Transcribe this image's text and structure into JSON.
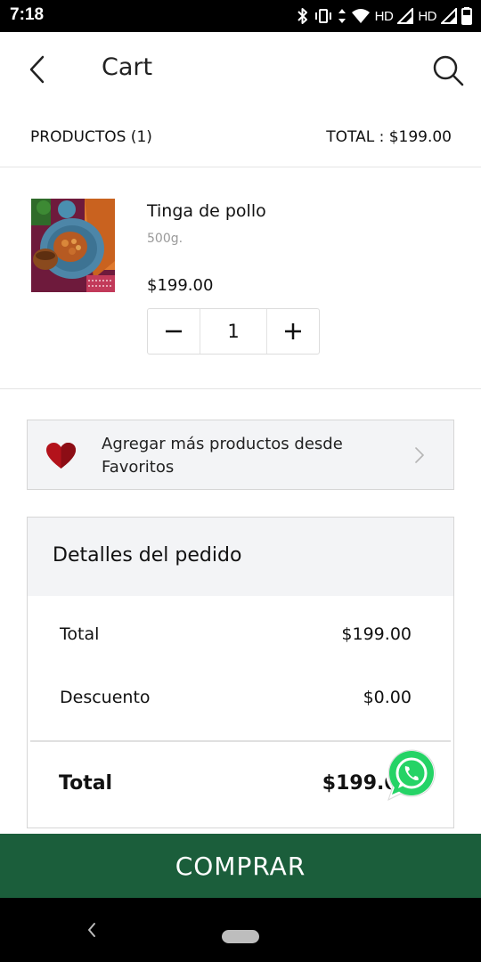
{
  "status_bar": {
    "time": "7:18",
    "network_label_1": "HD",
    "network_label_2": "HD",
    "icons": [
      "bluetooth-icon",
      "vibrate-icon",
      "data-arrows-icon",
      "wifi-icon",
      "signal-icon",
      "signal-icon",
      "battery-icon"
    ]
  },
  "header": {
    "title": "Cart",
    "back_icon": "back-arrow-icon",
    "search_icon": "search-icon"
  },
  "summary": {
    "products_label": "PRODUCTOS (1)",
    "total_label": "TOTAL : $199.00"
  },
  "cart_items": [
    {
      "name": "Tinga de pollo",
      "weight": "500g.",
      "price": "$199.00",
      "quantity": "1"
    }
  ],
  "favorites_banner": {
    "text": "Agregar más productos desde Favoritos",
    "icon": "heart-icon"
  },
  "order_details": {
    "title": "Detalles del pedido",
    "rows": [
      {
        "label": "Total",
        "value": "$199.00"
      },
      {
        "label": "Descuento",
        "value": "$0.00"
      }
    ],
    "grand_total_label": "Total",
    "grand_total_value": "$199.00"
  },
  "checkout": {
    "label": "COMPRAR"
  },
  "colors": {
    "accent_green": "#1b5e3b",
    "whatsapp_green": "#25d366",
    "heart_red": "#b3121b",
    "panel_gray": "#f3f4f6"
  }
}
